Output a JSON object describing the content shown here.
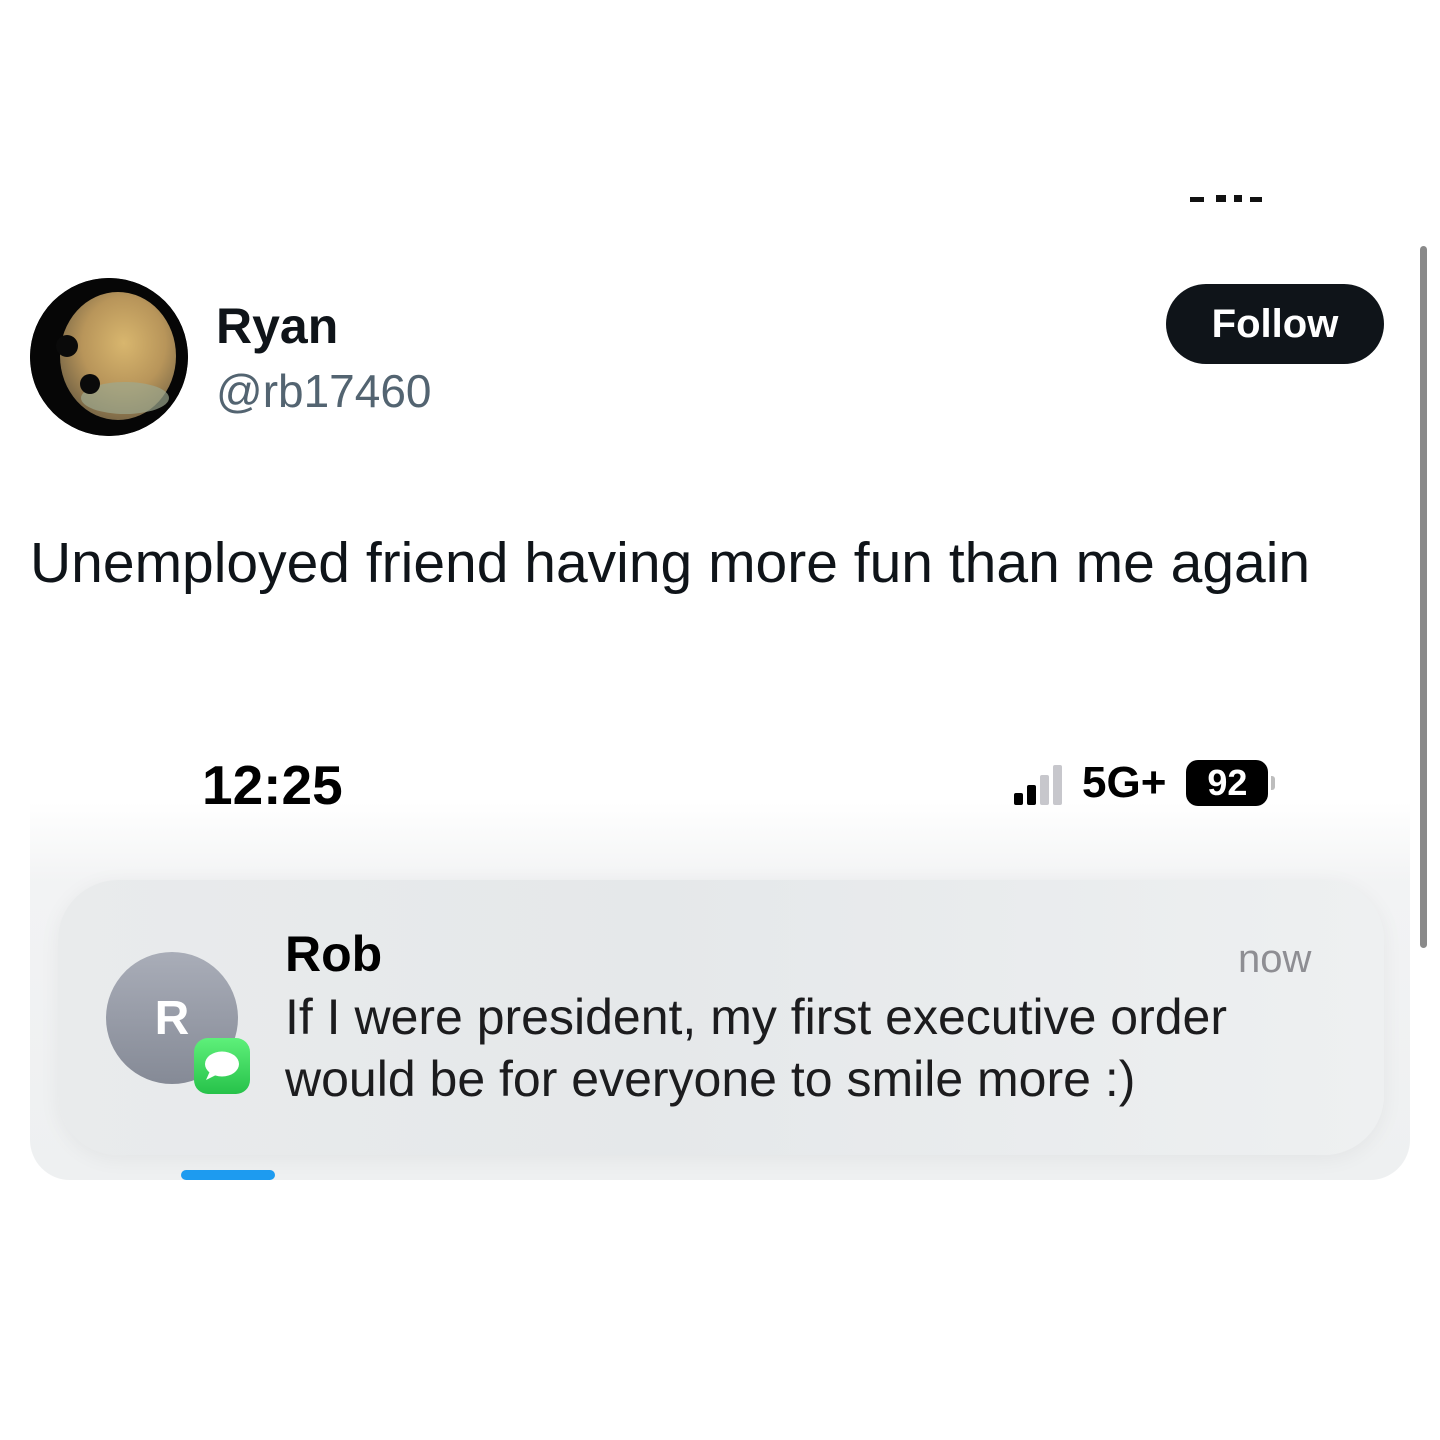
{
  "tweet": {
    "author": {
      "display_name": "Ryan",
      "handle": "@rb17460",
      "avatar_icon": "profile-photo"
    },
    "follow_label": "Follow",
    "text": "Unemployed friend having more fun than me again"
  },
  "screenshot": {
    "status_bar": {
      "time": "12:25",
      "network": "5G+",
      "battery": "92",
      "signal_bars_active": 2,
      "signal_bars_total": 4
    },
    "notification": {
      "contact_initial": "R",
      "app_icon": "messages-icon",
      "sender": "Rob",
      "time": "now",
      "message": "If I were president, my first executive order would be for everyone to smile more :)"
    }
  },
  "colors": {
    "follow_bg": "#0f1419",
    "handle": "#536471",
    "messages_green": "#34c759",
    "indicator_blue": "#1d9bf0"
  }
}
